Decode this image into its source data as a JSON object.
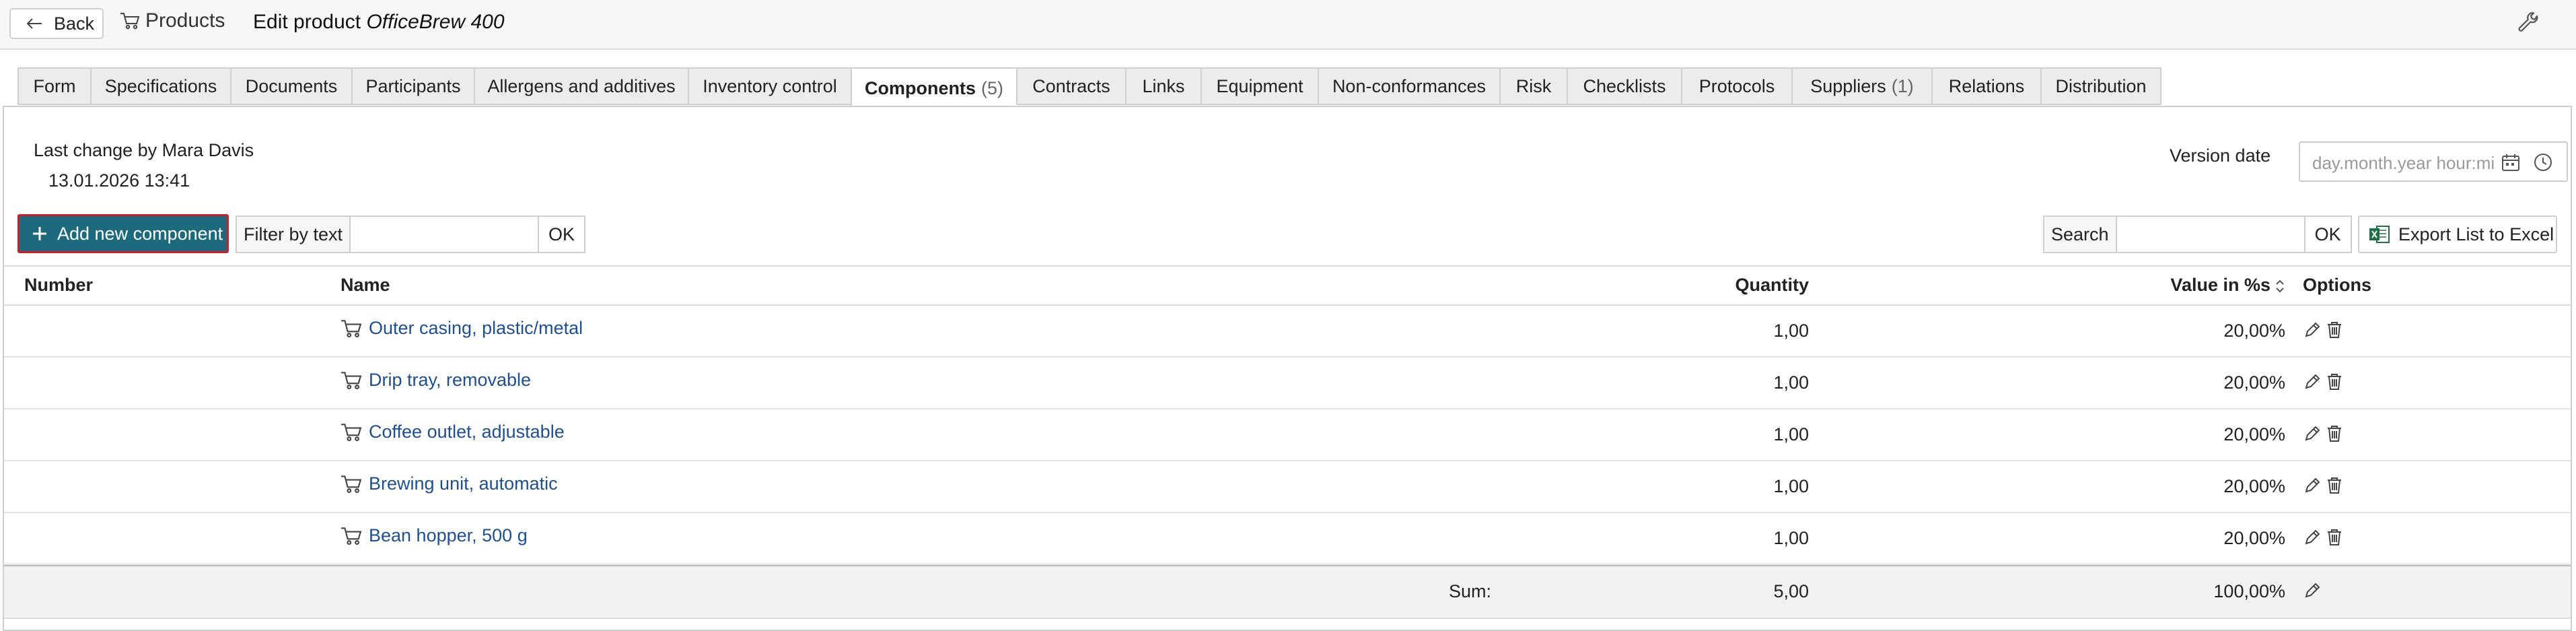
{
  "topbar": {
    "back_label": "Back",
    "products_label": "Products",
    "title_prefix": "Edit product",
    "title_product": "OfficeBrew 400"
  },
  "tabs": [
    {
      "label": "Form",
      "count": ""
    },
    {
      "label": "Specifications",
      "count": ""
    },
    {
      "label": "Documents",
      "count": ""
    },
    {
      "label": "Participants",
      "count": ""
    },
    {
      "label": "Allergens and additives",
      "count": ""
    },
    {
      "label": "Inventory control",
      "count": ""
    },
    {
      "label": "Components",
      "count": "(5)"
    },
    {
      "label": "Contracts",
      "count": ""
    },
    {
      "label": "Links",
      "count": ""
    },
    {
      "label": "Equipment",
      "count": ""
    },
    {
      "label": "Non-conformances",
      "count": ""
    },
    {
      "label": "Risk",
      "count": ""
    },
    {
      "label": "Checklists",
      "count": ""
    },
    {
      "label": "Protocols",
      "count": ""
    },
    {
      "label": "Suppliers",
      "count": "(1)"
    },
    {
      "label": "Relations",
      "count": ""
    },
    {
      "label": "Distribution",
      "count": ""
    }
  ],
  "meta": {
    "last_change": "Last change by Mara Davis",
    "last_change_date": "13.01.2026 13:41",
    "version_label": "Version date",
    "version_placeholder": "day.month.year hour:minute"
  },
  "toolbar": {
    "add_label": "Add new component",
    "filter_label": "Filter by text",
    "filter_value": "",
    "filter_ok": "OK",
    "search_label": "Search",
    "search_value": "",
    "search_ok": "OK",
    "export_label": "Export List to Excel"
  },
  "table": {
    "headers": {
      "number": "Number",
      "name": "Name",
      "quantity": "Quantity",
      "value": "Value in %s",
      "options": "Options"
    },
    "rows": [
      {
        "number": "",
        "name": "Outer casing, plastic/metal",
        "quantity": "1,00",
        "value": "20,00%"
      },
      {
        "number": "",
        "name": "Drip tray, removable",
        "quantity": "1,00",
        "value": "20,00%"
      },
      {
        "number": "",
        "name": "Coffee outlet, adjustable",
        "quantity": "1,00",
        "value": "20,00%"
      },
      {
        "number": "",
        "name": "Brewing unit, automatic",
        "quantity": "1,00",
        "value": "20,00%"
      },
      {
        "number": "",
        "name": "Bean hopper, 500 g",
        "quantity": "1,00",
        "value": "20,00%"
      }
    ],
    "sum": {
      "label": "Sum:",
      "quantity": "5,00",
      "value": "100,00%"
    }
  },
  "colors": {
    "primary_button": "#1d6a7f",
    "focus_outline": "#c8202a",
    "link": "#1f4f8f",
    "excel_green": "#1e7145"
  },
  "icons": {
    "back": "arrow-left-icon",
    "products": "cart-icon",
    "wrench": "wrench-icon",
    "calendar": "calendar-icon",
    "clock": "clock-icon",
    "add": "plus-icon",
    "excel": "excel-icon",
    "sort": "sort-icon",
    "edit": "pencil-icon",
    "delete": "trash-icon"
  }
}
